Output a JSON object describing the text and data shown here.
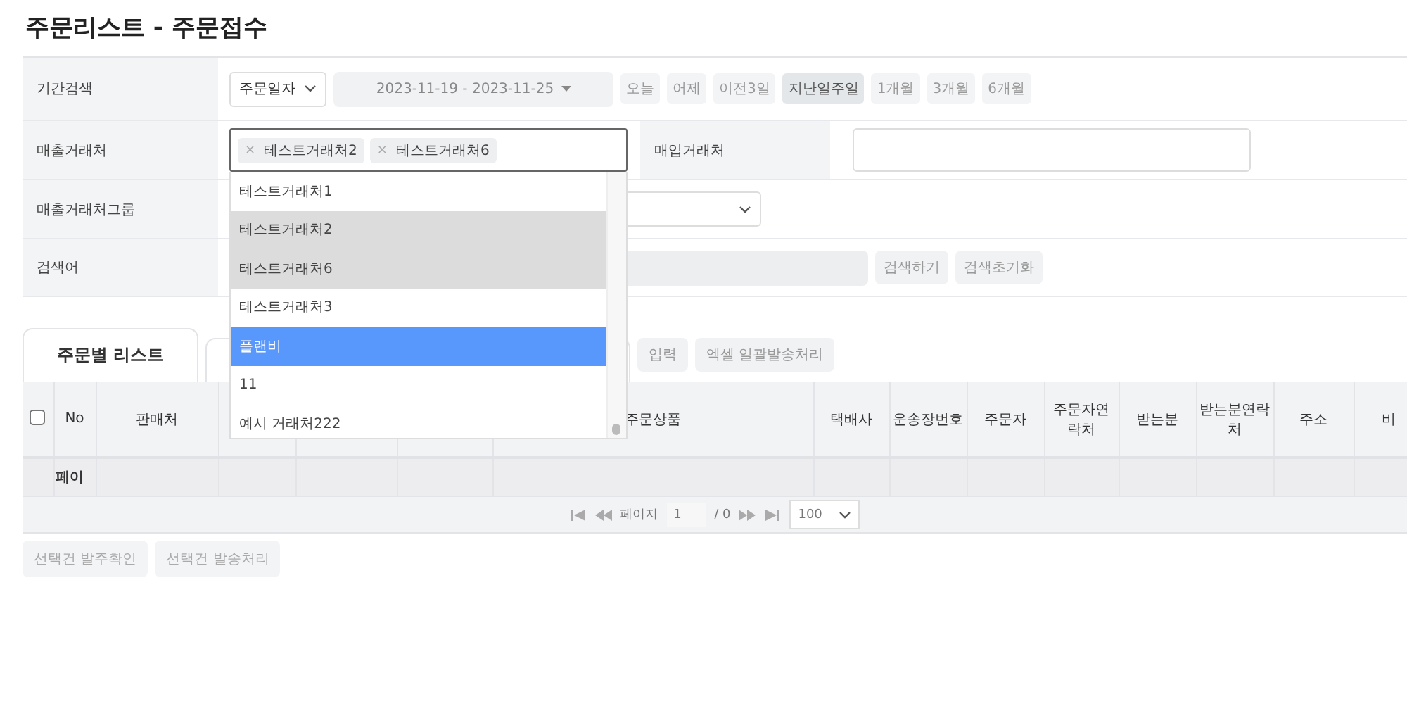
{
  "page": {
    "title": "주문리스트 - 주문접수"
  },
  "filters": {
    "period": {
      "label": "기간검색",
      "date_type": "주문일자",
      "date_range": "2023-11-19 - 2023-11-25",
      "presets": [
        {
          "label": "오늘",
          "selected": false
        },
        {
          "label": "어제",
          "selected": false
        },
        {
          "label": "이전3일",
          "selected": false
        },
        {
          "label": "지난일주일",
          "selected": true
        },
        {
          "label": "1개월",
          "selected": false
        },
        {
          "label": "3개월",
          "selected": false
        },
        {
          "label": "6개월",
          "selected": false
        }
      ]
    },
    "sales_client": {
      "label": "매출거래처",
      "tags": [
        {
          "remove": "×",
          "label": "테스트거래처2"
        },
        {
          "remove": "×",
          "label": "테스트거래처6"
        }
      ]
    },
    "purchase_client": {
      "label": "매입거래처"
    },
    "sales_group": {
      "label": "매출거래처그룹"
    },
    "keyword": {
      "label": "검색어",
      "buttons": [
        "검색하기",
        "검색초기화"
      ]
    }
  },
  "dropdown": {
    "options": [
      {
        "label": "테스트거래처1",
        "selected": false,
        "highlighted": false
      },
      {
        "label": "테스트거래처2",
        "selected": true,
        "highlighted": false
      },
      {
        "label": "테스트거래처6",
        "selected": true,
        "highlighted": false
      },
      {
        "label": "테스트거래처3",
        "selected": false,
        "highlighted": false
      },
      {
        "label": "플랜비",
        "selected": false,
        "highlighted": true
      },
      {
        "label": "11",
        "selected": false,
        "highlighted": false
      },
      {
        "label": "예시 거래처222",
        "selected": false,
        "highlighted": false
      }
    ]
  },
  "tabs": [
    {
      "label": "주문별 리스트",
      "selected": true
    }
  ],
  "actions": [
    "입력",
    "엑셀 일괄발송처리"
  ],
  "table": {
    "select_all": {
      "checked": false
    },
    "columns": [
      "No",
      "판매처",
      "주문상품",
      "택배사",
      "운송장번호",
      "주문자",
      "주문자연락처",
      "받는분",
      "받는분연락처",
      "주소",
      "비"
    ],
    "rows": [
      {
        "cells": [
          "페이"
        ]
      }
    ]
  },
  "pagination": {
    "page_label": "페이지",
    "page": "1",
    "total": "/ 0",
    "page_size": "100"
  },
  "bottom_buttons": [
    "선택건 발주확인",
    "선택건 발송처리"
  ]
}
